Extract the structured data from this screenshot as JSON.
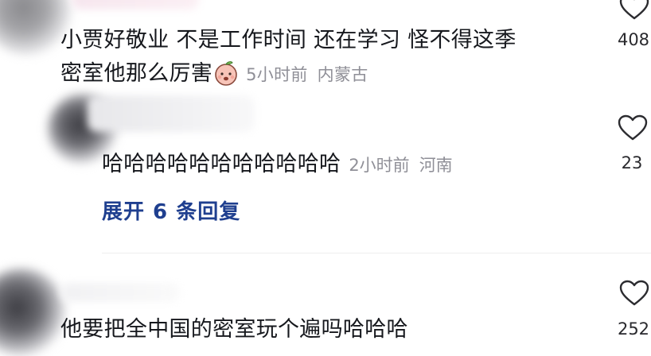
{
  "comments": [
    {
      "text_line1": "小贾好敬业 不是工作时间 还在学习  怪不得这季",
      "text_line2": "密室他那么厉害",
      "emoji": "peach-face-emoji",
      "time": "5小时前",
      "location": "内蒙古",
      "likes": "408"
    },
    {
      "reply_text": "哈哈哈哈哈哈哈哈哈哈哈",
      "time": "2小时前",
      "location": "河南",
      "likes": "23"
    }
  ],
  "expand_replies": "展开 6 条回复",
  "third_comment": {
    "text": "他要把全中国的密室玩个遍吗哈哈哈",
    "likes": "252"
  },
  "colors": {
    "text": "#16181d",
    "meta": "#8f8f97",
    "link": "#1f3f8f",
    "heart_stroke": "#2b2b2f"
  }
}
